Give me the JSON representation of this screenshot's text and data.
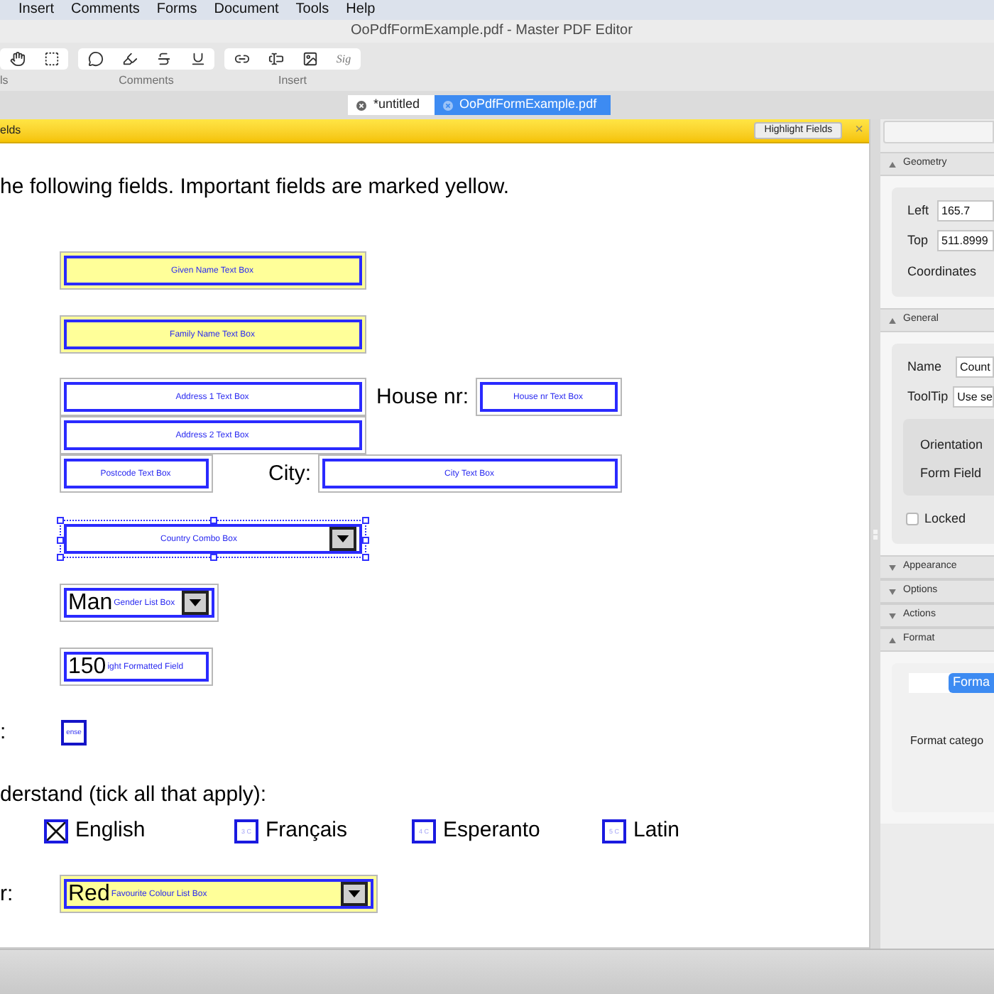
{
  "menu": {
    "items": [
      "Insert",
      "Comments",
      "Forms",
      "Document",
      "Tools",
      "Help"
    ]
  },
  "window": {
    "title": "OoPdfFormExample.pdf - Master PDF Editor"
  },
  "toolbar": {
    "groups": [
      {
        "label": "ls",
        "tools": [
          {
            "kind": "hand"
          },
          {
            "kind": "select"
          }
        ]
      },
      {
        "label": "Comments",
        "tools": [
          {
            "kind": "comment"
          },
          {
            "kind": "highlight"
          },
          {
            "kind": "strikeout"
          },
          {
            "kind": "underline"
          }
        ]
      },
      {
        "label": "Insert",
        "tools": [
          {
            "kind": "link"
          },
          {
            "kind": "text_field"
          },
          {
            "kind": "image"
          },
          {
            "kind": "signature",
            "text": "Sig"
          }
        ]
      }
    ]
  },
  "tabs": [
    {
      "label": "*untitled",
      "selected": false
    },
    {
      "label": "OoPdfFormExample.pdf",
      "selected": true
    }
  ],
  "notice_bar": {
    "text": "elds",
    "button": "Highlight Fields",
    "close": "×"
  },
  "form": {
    "intro": "he following fields. Important fields are marked yellow.",
    "rows": [
      {
        "items": [
          {
            "kind": "text_field",
            "name": "Given Name Text Box",
            "important": true,
            "selected": false
          }
        ]
      },
      {
        "items": [
          {
            "kind": "text_field",
            "name": "Family Name Text Box",
            "important": true,
            "selected": false
          }
        ]
      },
      {
        "items": [
          {
            "kind": "text_field",
            "name": "Address 1 Text Box",
            "important": false,
            "selected": false
          },
          {
            "kind": "caption",
            "text": "House nr:"
          },
          {
            "kind": "text_field",
            "name": "House nr Text Box",
            "important": false,
            "selected": false
          }
        ]
      },
      {
        "items": [
          {
            "kind": "text_field",
            "name": "Address 2 Text Box",
            "important": false,
            "selected": false
          }
        ]
      },
      {
        "items": [
          {
            "kind": "text_field",
            "name": "Postcode Text Box",
            "important": false,
            "selected": false
          },
          {
            "kind": "caption",
            "text": "City:"
          },
          {
            "kind": "text_field",
            "name": "City Text Box",
            "important": false,
            "selected": false
          }
        ]
      },
      {
        "items": [
          {
            "kind": "combo_box",
            "name": "Country Combo Box",
            "important": false,
            "selected": true
          }
        ]
      },
      {
        "items": [
          {
            "kind": "list_box",
            "name": "Gender List Box",
            "value": "Man",
            "important": false,
            "selected": false
          }
        ]
      },
      {
        "items": [
          {
            "kind": "text_field",
            "name": "ight Formatted Field",
            "value": "150",
            "important": false,
            "selected": false
          }
        ]
      },
      {
        "lead": ":",
        "items": [
          {
            "kind": "check_field",
            "name": "ense"
          }
        ]
      },
      {
        "items": [
          {
            "kind": "caption",
            "text": "derstand (tick all that apply):"
          }
        ]
      },
      {
        "items": [
          {
            "kind": "checkbox",
            "caption": "English",
            "checked": true
          },
          {
            "kind": "checkbox",
            "caption": "Français",
            "checked": false,
            "box_text": "3 C"
          },
          {
            "kind": "checkbox",
            "caption": "Esperanto",
            "checked": false,
            "box_text": "4 C"
          },
          {
            "kind": "checkbox",
            "caption": "Latin",
            "checked": false,
            "box_text": "5 C"
          }
        ]
      },
      {
        "lead": "r:",
        "items": [
          {
            "kind": "list_box",
            "name": "Favourite Colour List Box",
            "value": "Red",
            "important": true,
            "selected": false
          }
        ]
      }
    ]
  },
  "properties": {
    "sections": [
      {
        "title": "Geometry",
        "expanded": true,
        "fields": [
          {
            "label": "Left",
            "value": "165.7"
          },
          {
            "label": "Top",
            "value": "511.8999"
          }
        ],
        "note": "Coordinates"
      },
      {
        "title": "General",
        "expanded": true,
        "fields": [
          {
            "label": "Name",
            "value": "Count"
          },
          {
            "label": "ToolTip",
            "value": "Use se"
          }
        ],
        "group": [
          "Orientation",
          "Form Field"
        ],
        "checkbox": {
          "label": "Locked",
          "checked": false
        }
      },
      {
        "title": "Appearance",
        "expanded": false
      },
      {
        "title": "Options",
        "expanded": false
      },
      {
        "title": "Actions",
        "expanded": false
      },
      {
        "title": "Format",
        "expanded": true,
        "tabs": [
          {
            "label": "Forma",
            "selected": true
          }
        ],
        "note": "Format catego"
      }
    ]
  }
}
